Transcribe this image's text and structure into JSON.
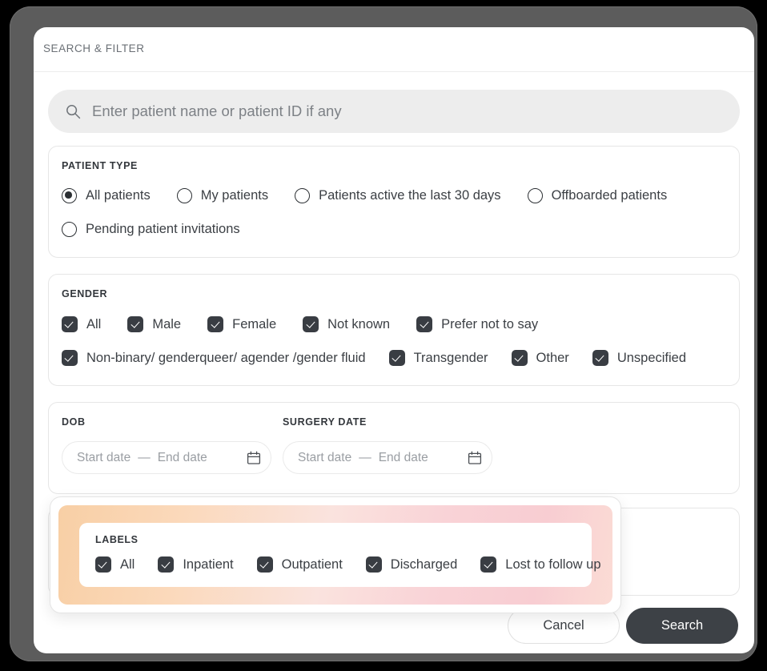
{
  "header": {
    "title": "SEARCH & FILTER"
  },
  "search": {
    "placeholder": "Enter patient name or patient ID if any",
    "value": "",
    "icon": "search-icon"
  },
  "patient_type": {
    "title": "PATIENT TYPE",
    "control": "radio",
    "options": [
      {
        "label": "All patients",
        "checked": true
      },
      {
        "label": "My patients",
        "checked": false
      },
      {
        "label": "Patients active the last 30 days",
        "checked": false
      },
      {
        "label": "Offboarded patients",
        "checked": false
      },
      {
        "label": "Pending patient invitations",
        "checked": false
      }
    ]
  },
  "gender": {
    "title": "GENDER",
    "control": "checkbox",
    "options": [
      {
        "label": "All",
        "checked": true
      },
      {
        "label": "Male",
        "checked": true
      },
      {
        "label": "Female",
        "checked": true
      },
      {
        "label": "Not known",
        "checked": true
      },
      {
        "label": "Prefer not to say",
        "checked": true
      },
      {
        "label": "Non-binary/ genderqueer/ agender /gender fluid",
        "checked": true
      },
      {
        "label": "Transgender",
        "checked": true
      },
      {
        "label": "Other",
        "checked": true
      },
      {
        "label": "Unspecified",
        "checked": true
      }
    ]
  },
  "dates": {
    "dob": {
      "title": "DOB",
      "start_placeholder": "Start date",
      "separator": "—",
      "end_placeholder": "End date",
      "icon": "calendar-icon"
    },
    "surgery": {
      "title": "SURGERY DATE",
      "start_placeholder": "Start date",
      "separator": "—",
      "end_placeholder": "End date",
      "icon": "calendar-icon"
    }
  },
  "labels": {
    "title": "LABELS",
    "control": "checkbox",
    "highlighted": true,
    "highlight_gradient_start": "#f8cfa5",
    "highlight_gradient_end": "#f8cdd2",
    "options": [
      {
        "label": "All",
        "checked": true
      },
      {
        "label": "Inpatient",
        "checked": true
      },
      {
        "label": "Outpatient",
        "checked": true
      },
      {
        "label": "Discharged",
        "checked": true
      },
      {
        "label": "Lost to follow up",
        "checked": true
      }
    ]
  },
  "footer": {
    "cancel_label": "Cancel",
    "search_label": "Search",
    "search_button_color": "#3d4146"
  }
}
